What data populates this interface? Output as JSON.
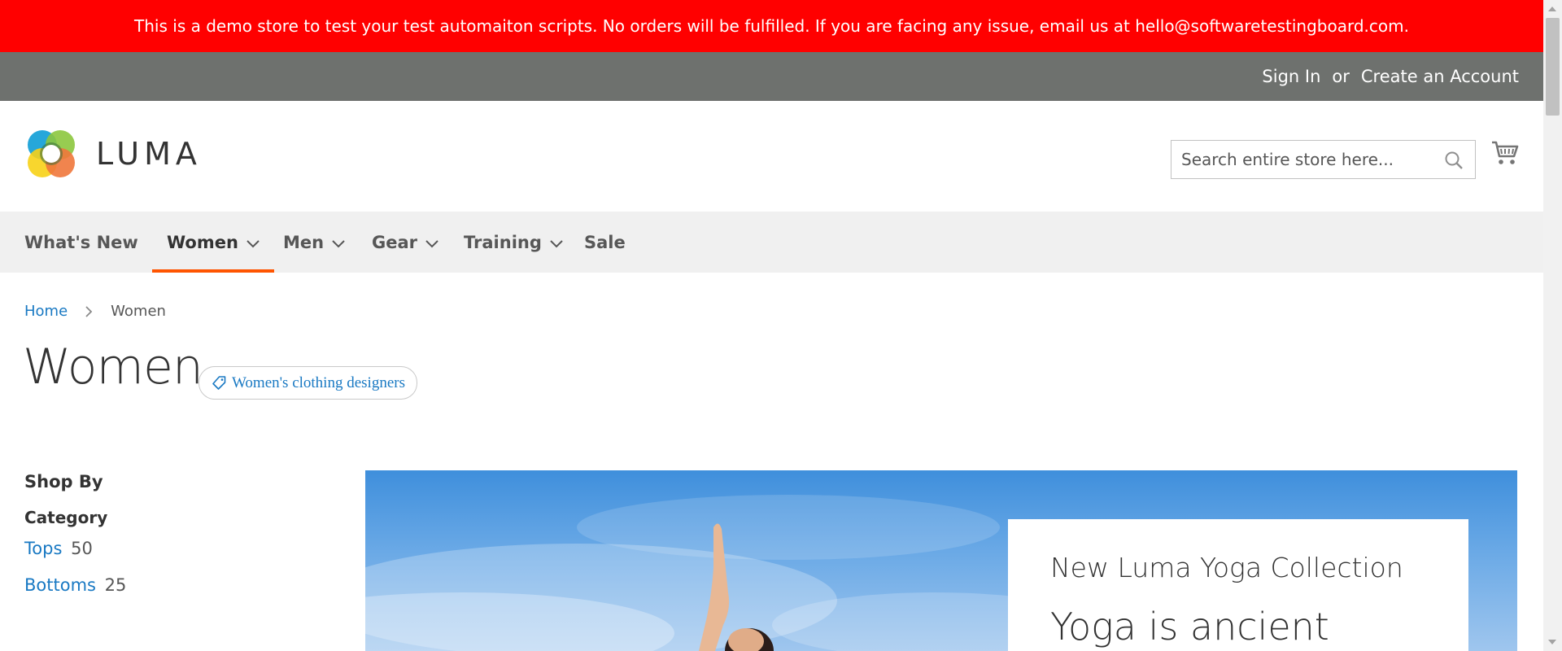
{
  "notice": {
    "text": "This is a demo store to test your test automaiton scripts. No orders will be fulfilled. If you are facing any issue, email us at hello@softwaretestingboard.com."
  },
  "panel": {
    "sign_in": "Sign In",
    "or": "or",
    "create_account": "Create an Account"
  },
  "header": {
    "logo_text": "LUMA",
    "search_placeholder": "Search entire store here...",
    "search_value": ""
  },
  "nav": {
    "items": [
      {
        "label": "What's New",
        "has_dropdown": false,
        "active": false
      },
      {
        "label": "Women",
        "has_dropdown": true,
        "active": true
      },
      {
        "label": "Men",
        "has_dropdown": true,
        "active": false
      },
      {
        "label": "Gear",
        "has_dropdown": true,
        "active": false
      },
      {
        "label": "Training",
        "has_dropdown": true,
        "active": false
      },
      {
        "label": "Sale",
        "has_dropdown": false,
        "active": false
      }
    ]
  },
  "breadcrumb": {
    "home": "Home",
    "current": "Women"
  },
  "page": {
    "title": "Women",
    "tag": "Women's clothing designers"
  },
  "sidebar": {
    "shop_by": "Shop By",
    "category_title": "Category",
    "filters": [
      {
        "label": "Tops",
        "count": "50"
      },
      {
        "label": "Bottoms",
        "count": "25"
      }
    ]
  },
  "hero": {
    "subtitle": "New Luma Yoga Collection",
    "heading": "Yoga is ancient"
  },
  "colors": {
    "notice_bg": "#ff0000",
    "panel_bg": "#6e716e",
    "nav_bg": "#f0f0f0",
    "accent": "#ff5501",
    "link": "#1979c3"
  },
  "icons": {
    "search": "search-icon",
    "cart": "cart-icon",
    "chevron": "chevron-down-icon",
    "breadcrumb_sep": "chevron-right-icon",
    "tag": "tag-icon"
  }
}
